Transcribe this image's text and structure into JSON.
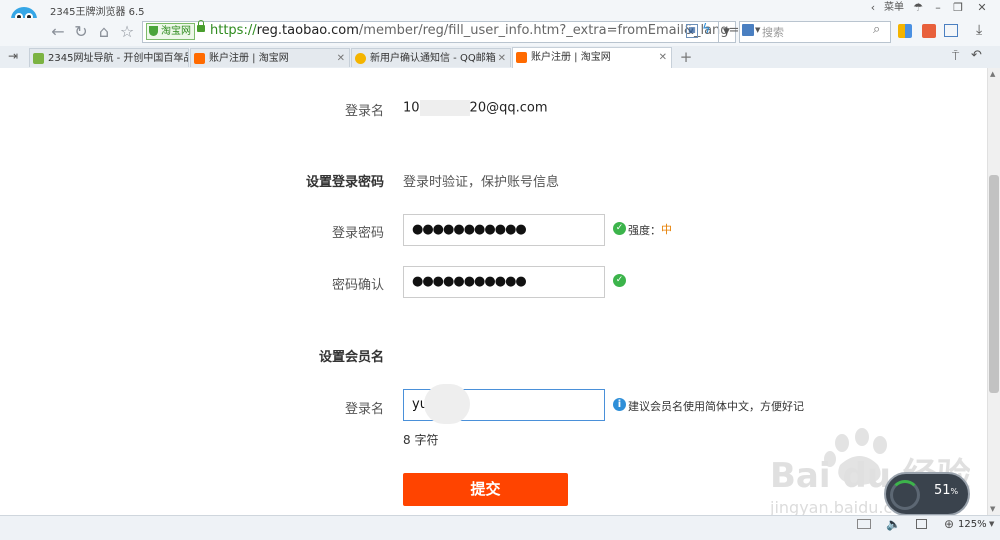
{
  "window": {
    "title": "2345王牌浏览器 6.5",
    "menu_label": "菜单"
  },
  "address_bar": {
    "site_badge": "淘宝网",
    "url_scheme": "https://",
    "url_domain": "reg.taobao.com",
    "url_path": "/member/reg/fill_user_info.htm?_extra=fromEmail&_lang=zh-S",
    "search_placeholder": "搜索"
  },
  "tabs": [
    {
      "label": "2345网址导航 - 开创中国百年品",
      "favicon_color": "#7cb342",
      "active": false
    },
    {
      "label": "账户注册 | 淘宝网",
      "favicon_color": "#ff6a00",
      "active": false
    },
    {
      "label": "新用户确认通知信 - QQ邮箱",
      "favicon_color": "#f4b400",
      "active": false
    },
    {
      "label": "账户注册 | 淘宝网",
      "favicon_color": "#ff6a00",
      "active": true
    }
  ],
  "form": {
    "login_name_label": "登录名",
    "login_name_prefix": "10",
    "login_name_suffix": "20@qq.com",
    "password_section_title": "设置登录密码",
    "password_section_hint": "登录时验证，保护账号信息",
    "password_label": "登录密码",
    "password_value": "●●●●●●●●●●●",
    "strength_label": "强度：",
    "strength_value": "中",
    "confirm_label": "密码确认",
    "confirm_value": "●●●●●●●●●●●",
    "member_section_title": "设置会员名",
    "member_label": "登录名",
    "member_value": "yu",
    "member_hint": "建议会员名使用简体中文，方便好记",
    "char_count": "8 字符",
    "submit_label": "提交"
  },
  "status": {
    "zoom": "125%"
  },
  "watermark": {
    "brand": "Bai du 经验",
    "url": "jingyan.baidu.com",
    "speed_value": "51",
    "speed_unit": "%"
  },
  "colors": {
    "accent": "#ff4400",
    "success": "#3cb44b",
    "info": "#2f8fd8",
    "strength": "#e67e00"
  }
}
